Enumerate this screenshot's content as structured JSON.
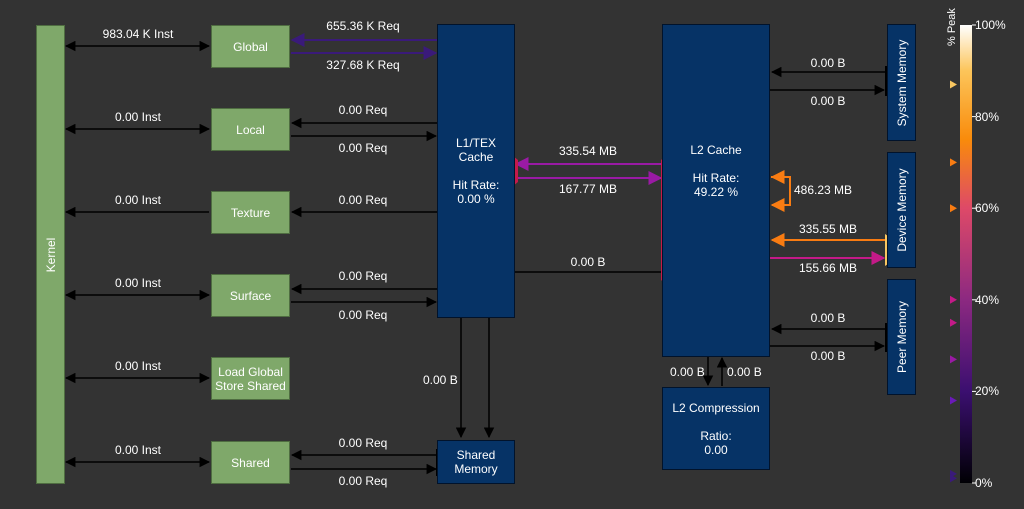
{
  "nodes": {
    "kernel": "Kernel",
    "global": "Global",
    "local": "Local",
    "texture": "Texture",
    "surface": "Surface",
    "load_global_line1": "Load Global",
    "load_global_line2": "Store Shared",
    "shared": "Shared",
    "l1tex": {
      "line1": "L1/TEX",
      "line2": "Cache",
      "hit_label": "Hit Rate:",
      "hit_value": "0.00 %"
    },
    "shared_memory": {
      "line1": "Shared",
      "line2": "Memory"
    },
    "l2": {
      "title": "L2 Cache",
      "hit_label": "Hit Rate:",
      "hit_value": "49.22 %"
    },
    "l2_compression": {
      "title": "L2 Compression",
      "ratio_label": "Ratio:",
      "ratio_value": "0.00"
    },
    "system_memory": "System Memory",
    "device_memory": "Device Memory",
    "peer_memory": "Peer Memory"
  },
  "links": {
    "kernel_global": "983.04 K Inst",
    "global_req_in": "655.36 K Req",
    "global_req_out": "327.68 K Req",
    "kernel_local": "0.00 Inst",
    "local_req_in": "0.00 Req",
    "local_req_out": "0.00 Req",
    "kernel_texture": "0.00 Inst",
    "texture_req": "0.00 Req",
    "kernel_surface": "0.00 Inst",
    "surface_req_in": "0.00 Req",
    "surface_req_out": "0.00 Req",
    "kernel_loadglobal": "0.00 Inst",
    "kernel_shared": "0.00 Inst",
    "shared_req_in": "0.00 Req",
    "shared_req_out": "0.00 Req",
    "l1_to_shared": "0.00 B",
    "l1_l2_read": "335.54 MB",
    "l1_l2_write": "167.77 MB",
    "shared_to_l2": "0.00 B",
    "l2_system_in": "0.00 B",
    "l2_system_out": "0.00 B",
    "l2_self": "486.23 MB",
    "l2_device_in": "335.55 MB",
    "l2_device_out": "155.66 MB",
    "l2_peer_in": "0.00 B",
    "l2_peer_out": "0.00 B",
    "l2_comp_left": "0.00 B",
    "l2_comp_right": "0.00 B"
  },
  "legend": {
    "title": "% Peak",
    "ticks": [
      "100%",
      "80%",
      "60%",
      "40%",
      "20%",
      "0%"
    ],
    "markers": [
      {
        "value": 87,
        "color": "#f8c660"
      },
      {
        "value": 70,
        "color": "#f97c12"
      },
      {
        "value": 60,
        "color": "#f97c12"
      },
      {
        "value": 40,
        "color": "#c41a88"
      },
      {
        "value": 35,
        "color": "#c41a88"
      },
      {
        "value": 27,
        "color": "#9a1aa4"
      },
      {
        "value": 18,
        "color": "#6a1ab8"
      },
      {
        "value": 2,
        "color": "#3a1a7a"
      },
      {
        "value": 1,
        "color": "#3a1a7a"
      }
    ]
  },
  "colors": {
    "background": "#333333",
    "unit_green": "#7fa86a",
    "cache_blue": "#063366",
    "global_arrow": "#3a1a7a",
    "l1_l2_arrow": "#9a1aa4",
    "port_red": "#c41a4a",
    "device_in": "#f97c12",
    "device_out": "#c41a88",
    "device_port": "#f8c660",
    "self_loop": "#f97c12"
  }
}
